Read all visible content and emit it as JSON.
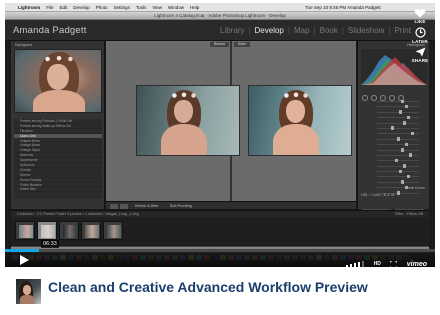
{
  "menubar": {
    "apple": "",
    "menus": [
      "Lightroom",
      "File",
      "Edit",
      "Develop",
      "Photo",
      "Settings",
      "Tools",
      "View",
      "Window",
      "Help"
    ],
    "clock": "Tue Sep 10  8:46 PM  Amanda Padgett"
  },
  "window": {
    "title": "Lightroom 4 Catalog.lrcat - Adobe Photoshop Lightroom - Develop"
  },
  "lightroom": {
    "identity_plate": "Amanda Padgett",
    "modules": [
      "Library",
      "Develop",
      "Map",
      "Book",
      "Slideshow",
      "Print"
    ],
    "active_module": "Develop",
    "separator": "|"
  },
  "share": {
    "like": "LIKE",
    "later": "LATER",
    "share": "SHARE"
  },
  "left_panel": {
    "navigator_label": "Navigator",
    "presets": [
      "Presets among Portraits 1.0 Kids Set",
      "Presets among Make-up Effects Set",
      "Flexitone",
      "Lilac's Grid",
      "Vintage Mixes",
      "Vintage Mixes",
      "Vintage Sepia",
      "Moments",
      "Daydreamer",
      "Splendour",
      "Cherish",
      "Serene",
      "Dream Sunday",
      "Pinkie Meadow",
      "Sweet Mint"
    ],
    "selected_preset_index": 3,
    "copy_label": "Copy...",
    "paste_label": "Paste"
  },
  "center": {
    "before_label": "Before",
    "after_label": "After",
    "toolbar_ba": "Before & After",
    "toolbar_soft": "Soft Proofing"
  },
  "right_panel": {
    "histogram_label": "Histogram",
    "tone_curve_label": "Tone Curve",
    "basic_label": "HSL / Color / B & W",
    "previous_label": "Previous",
    "reset_label": "Reset"
  },
  "filmstrip": {
    "info": "Collection : CC Preset Folder     5 photos / 1 selected / Abigail_Loop_1.dng",
    "filter_label": "Filter :",
    "filter_value": "Filters Off"
  },
  "player": {
    "timecode": "06:33",
    "progress": 0.08,
    "hd_label": "HD",
    "vimeo_label": "vimeo"
  },
  "caption": {
    "title": "Clean and Creative Advanced Workflow Preview"
  },
  "colors": {
    "accent": "#17a5ea",
    "title_blue": "#1b3f6d",
    "lr_dark": "#2a2a2a"
  }
}
